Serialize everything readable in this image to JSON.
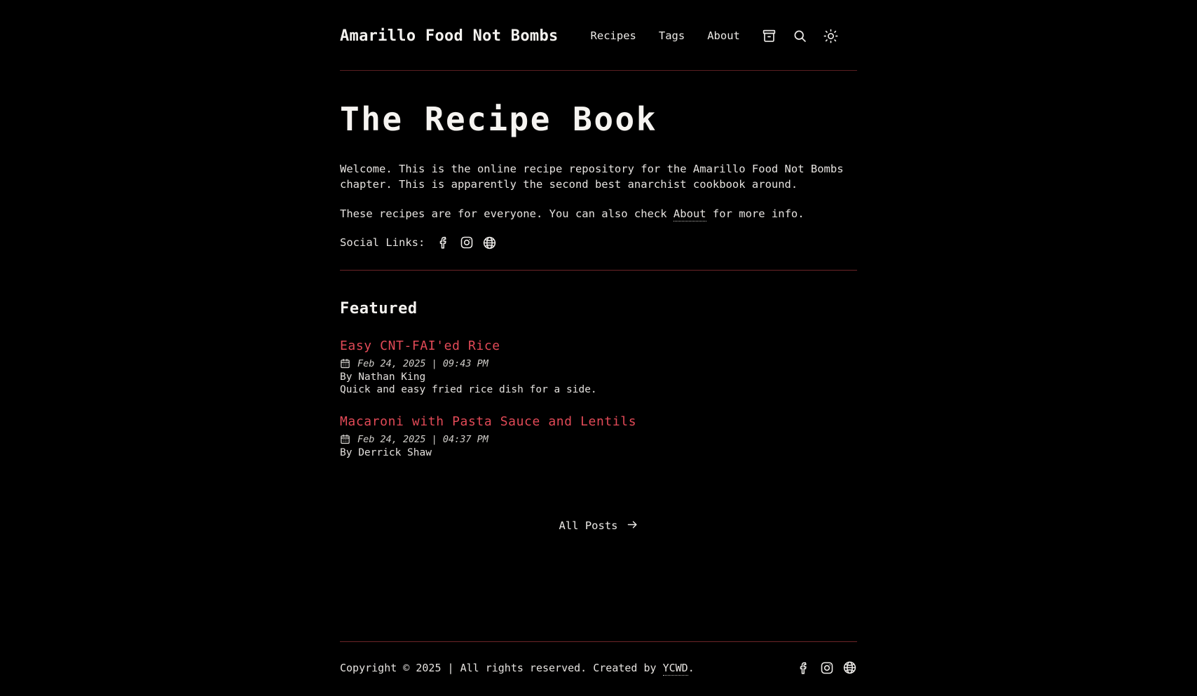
{
  "theme": {
    "background": "#000000",
    "text": "#e8e6e3",
    "accent_red": "#e24a57",
    "rule_red": "#6d2528"
  },
  "header": {
    "brand": "Amarillo Food Not Bombs",
    "nav": [
      {
        "label": "Recipes",
        "name": "nav-link-recipes"
      },
      {
        "label": "Tags",
        "name": "nav-link-tags"
      },
      {
        "label": "About",
        "name": "nav-link-about"
      }
    ],
    "icons": [
      {
        "name": "archive-icon",
        "title": "Archive"
      },
      {
        "name": "search-icon",
        "title": "Search"
      },
      {
        "name": "sun-icon",
        "title": "Toggle theme"
      }
    ]
  },
  "hero": {
    "title": "The Recipe Book",
    "paragraph_1": "Welcome. This is the online recipe repository for the Amarillo Food Not Bombs chapter. This is apparently the second best anarchist cookbook around.",
    "paragraph_2_before": "These recipes are for everyone. You can also check ",
    "paragraph_2_link": "About",
    "paragraph_2_after": " for more info.",
    "social_label": "Social Links:",
    "social_icons": [
      {
        "name": "facebook-icon",
        "title": "Facebook"
      },
      {
        "name": "instagram-icon",
        "title": "Instagram"
      },
      {
        "name": "website-icon",
        "title": "Website"
      }
    ]
  },
  "featured": {
    "heading": "Featured",
    "posts": [
      {
        "title": "Easy CNT-FAI'ed Rice",
        "date": "Feb 24, 2025 | 09:43 PM",
        "author": "By Nathan King",
        "description": "Quick and easy fried rice dish for a side."
      },
      {
        "title": "Macaroni with Pasta Sauce and Lentils",
        "date": "Feb 24, 2025 | 04:37 PM",
        "author": "By Derrick Shaw",
        "description": ""
      }
    ],
    "all_posts_label": "All Posts"
  },
  "footer": {
    "copyright_before": "Copyright © 2025 | All rights reserved. Created by ",
    "copyright_link": "YCWD",
    "copyright_after": ".",
    "social_icons": [
      {
        "name": "facebook-icon",
        "title": "Facebook"
      },
      {
        "name": "instagram-icon",
        "title": "Instagram"
      },
      {
        "name": "website-icon",
        "title": "Website"
      }
    ]
  }
}
